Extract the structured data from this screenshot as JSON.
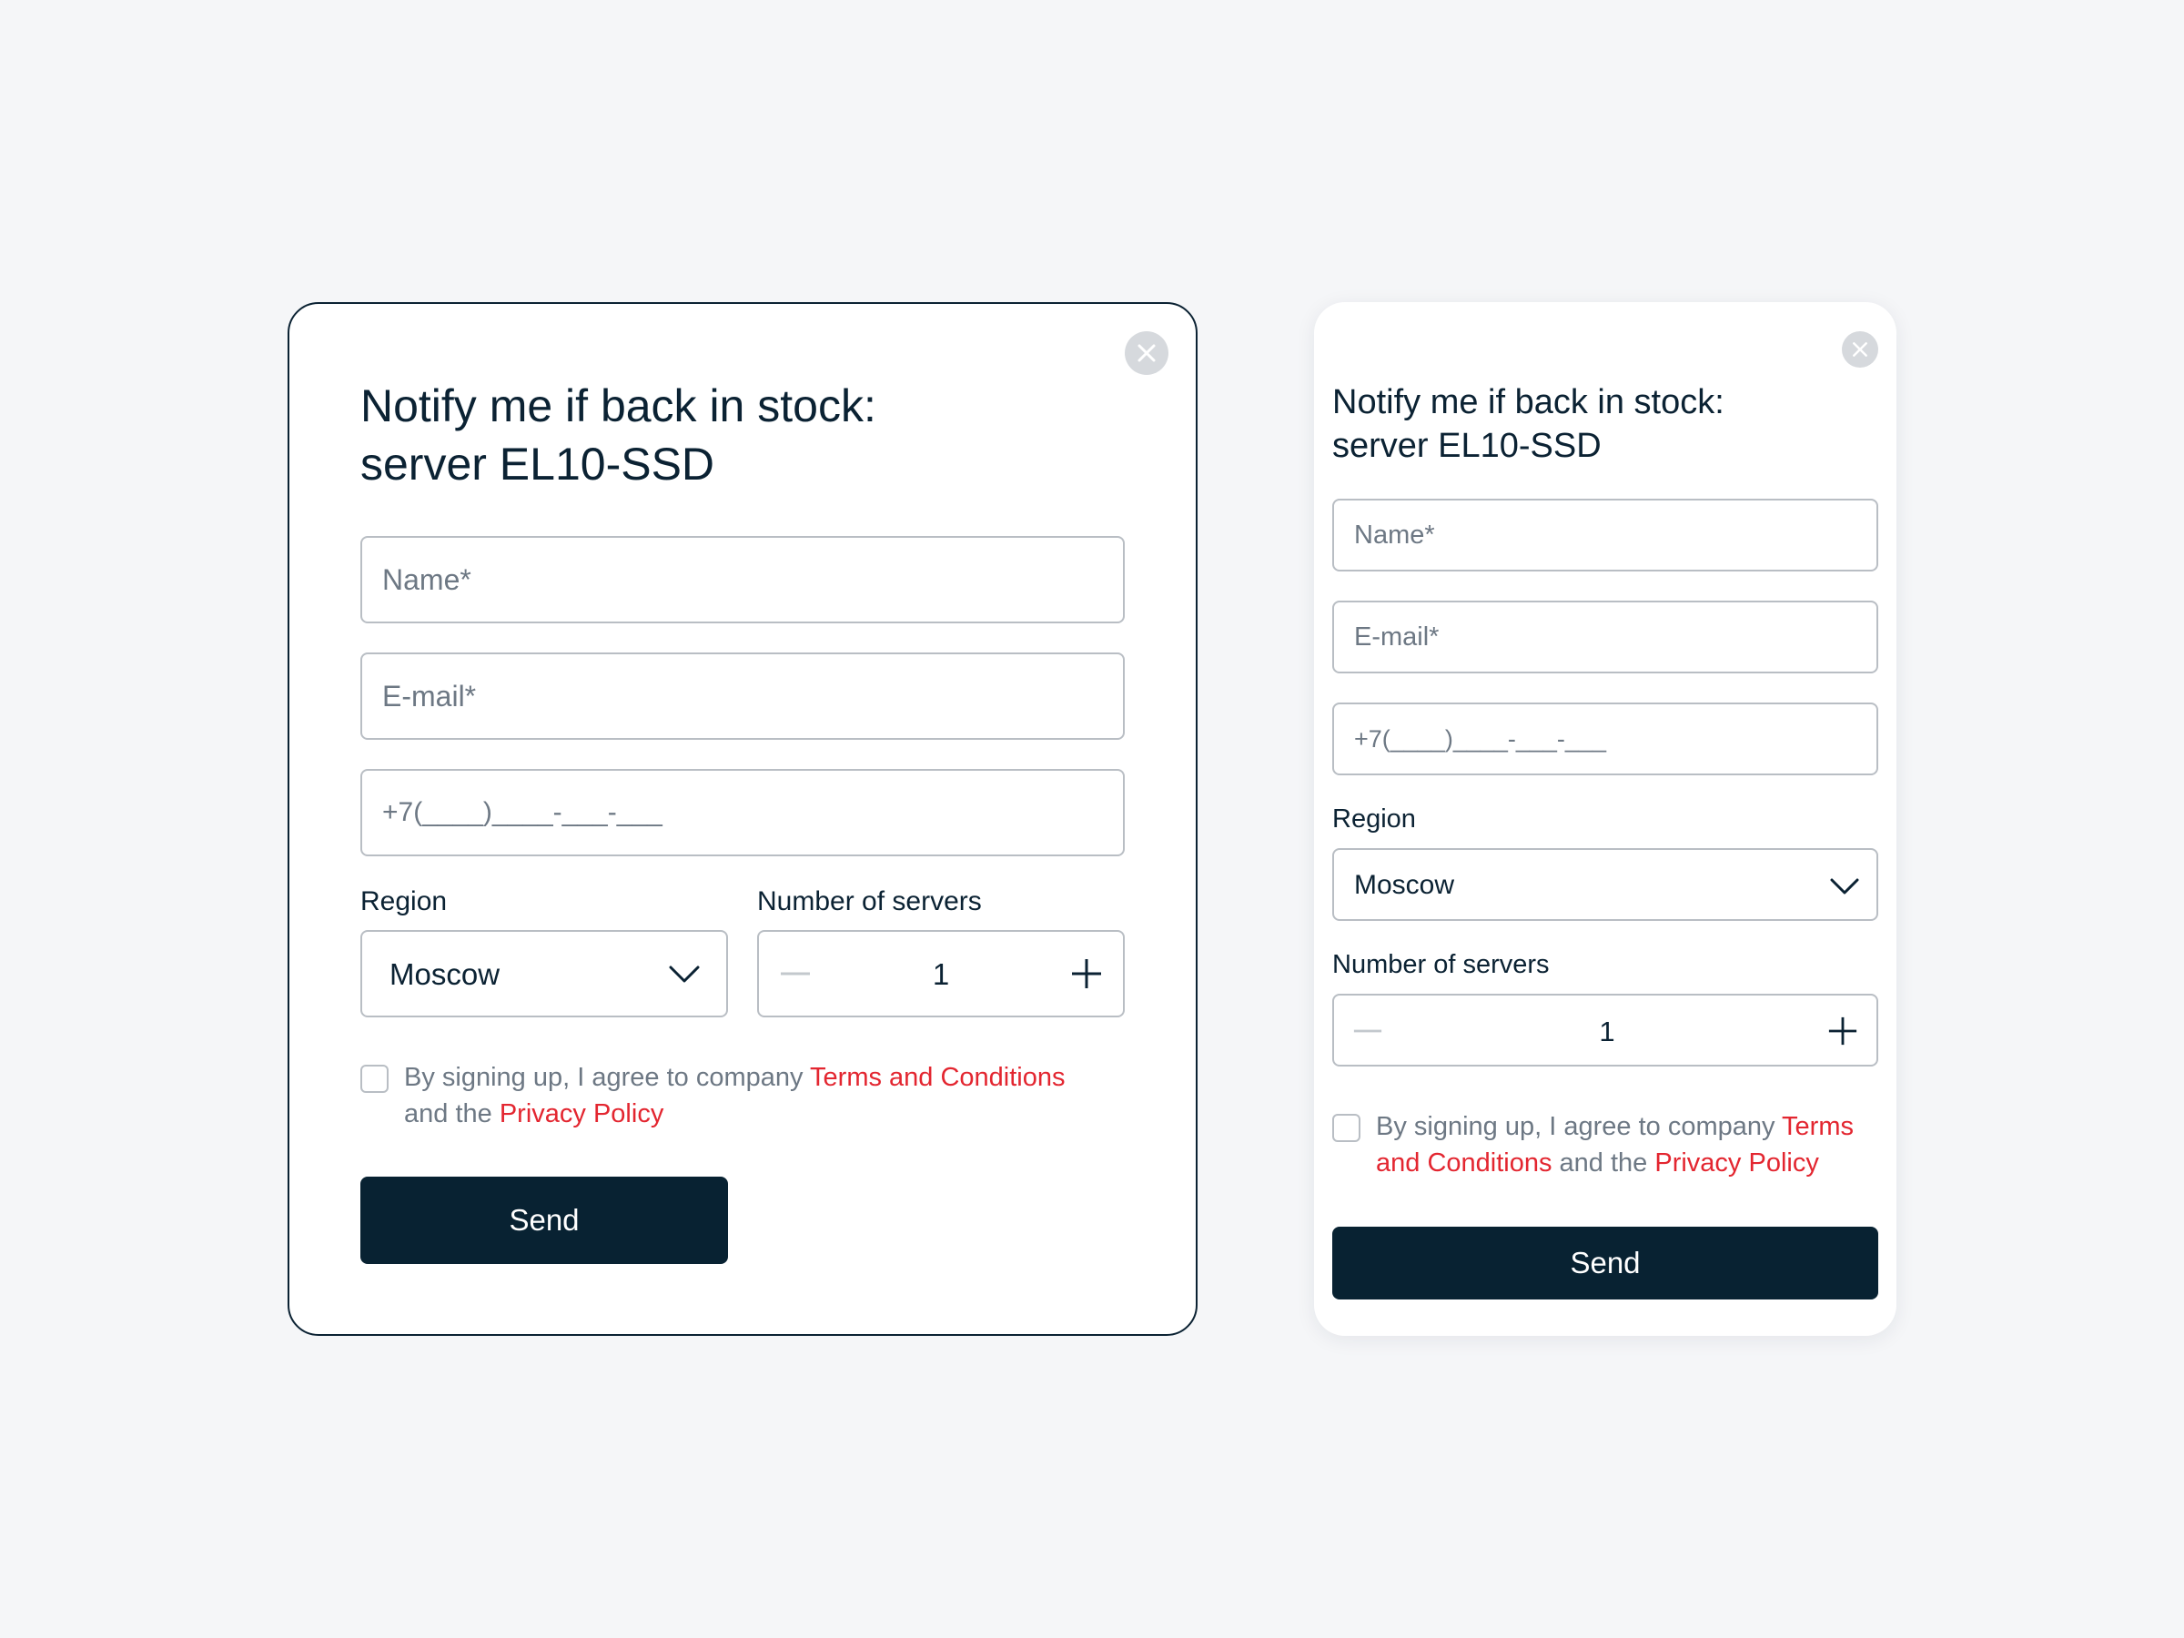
{
  "desktop": {
    "title_line1": "Notify me if back in stock:",
    "title_line2": "server EL10-SSD",
    "name_placeholder": "Name*",
    "email_placeholder": "E-mail*",
    "phone_placeholder": "+7(____)____-___-___",
    "region_label": "Region",
    "region_value": "Moscow",
    "servers_label": "Number of servers",
    "servers_value": "1",
    "consent_prefix": "By signing up, I agree to company ",
    "consent_terms": "Terms and Conditions",
    "consent_middle": " and the ",
    "consent_privacy": "Privacy Policy",
    "send_label": "Send"
  },
  "mobile": {
    "title_line1": "Notify me if back in stock:",
    "title_line2": "server EL10-SSD",
    "name_placeholder": "Name*",
    "email_placeholder": "E-mail*",
    "phone_placeholder": "+7(____)____-___-___",
    "region_label": "Region",
    "region_value": "Moscow",
    "servers_label": "Number of servers",
    "servers_value": "1",
    "consent_prefix": "By signing up, I agree to company ",
    "consent_terms": "Terms and Conditions",
    "consent_middle": " and the ",
    "consent_privacy": "Privacy Policy",
    "send_label": "Send"
  },
  "icons": {
    "close": "close-icon",
    "chevron": "chevron-down-icon",
    "minus": "minus-icon",
    "plus": "plus-icon"
  },
  "colors": {
    "background": "#f5f6f8",
    "primary_dark": "#082232",
    "link_red": "#e32630",
    "border_gray": "#b9bec4",
    "close_gray": "#d6d9dd"
  }
}
